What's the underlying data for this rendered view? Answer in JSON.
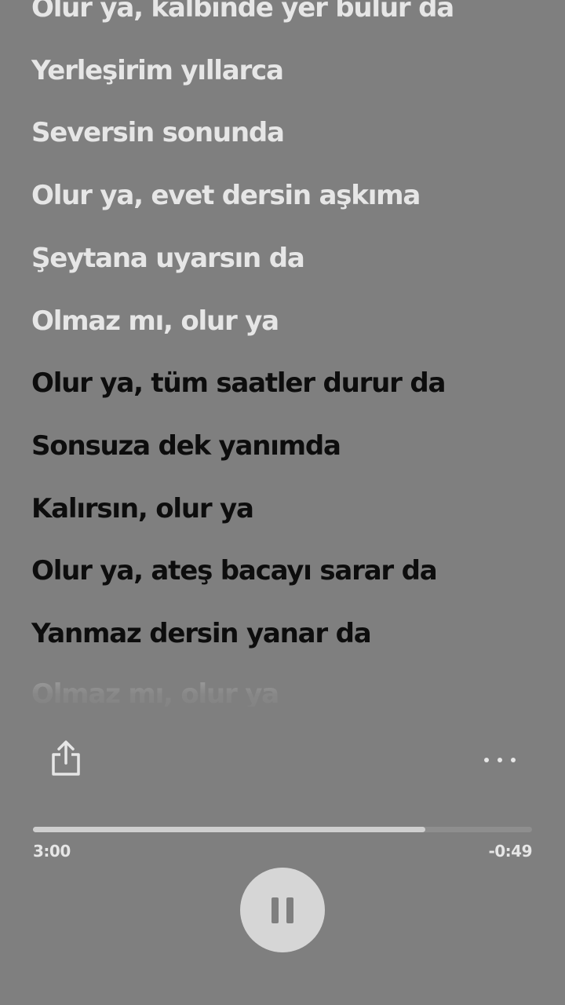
{
  "lyrics": [
    {
      "text": "Olur ya, kalbinde yer bulur da",
      "state": "past"
    },
    {
      "text": "Yerleşirim yıllarca",
      "state": "past"
    },
    {
      "text": "Seversin sonunda",
      "state": "past"
    },
    {
      "text": "Olur ya, evet dersin aşkıma",
      "state": "past"
    },
    {
      "text": "Şeytana uyarsın da",
      "state": "past"
    },
    {
      "text": "Olmaz mı, olur ya",
      "state": "past"
    },
    {
      "text": "Olur ya, tüm saatler durur da",
      "state": "current"
    },
    {
      "text": "Sonsuza dek yanımda",
      "state": "current"
    },
    {
      "text": "Kalırsın, olur ya",
      "state": "current"
    },
    {
      "text": "Olur ya, ateş bacayı sarar da",
      "state": "current"
    },
    {
      "text": "Yanmaz dersin yanar da",
      "state": "current"
    },
    {
      "text": "Olmaz mı, olur ya",
      "state": "fade"
    }
  ],
  "controls": {
    "share_icon": "share-icon",
    "more_icon": "more-horizontal-icon",
    "pause_icon": "pause-icon"
  },
  "playback": {
    "elapsed": "3:00",
    "remaining": "-0:49",
    "progress_fraction": 0.786
  },
  "colors": {
    "background": "#7f7f7f",
    "past_lyric": "#e6e6e6",
    "current_lyric": "#0d0d0d",
    "progress_fill": "#cfcfcf",
    "progress_track": "#8e8e8e",
    "pause_button": "#d6d6d6"
  }
}
